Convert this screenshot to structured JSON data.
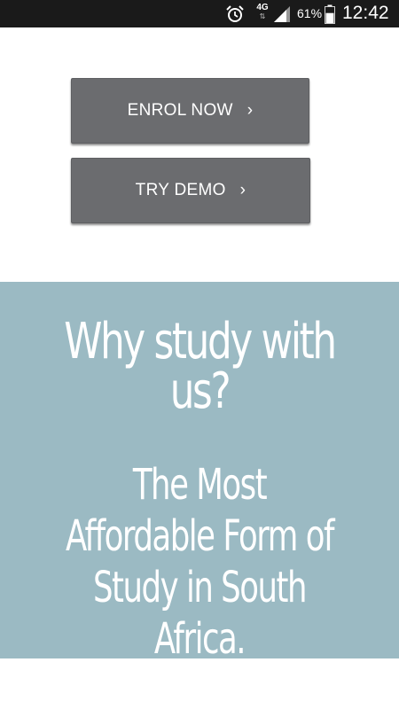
{
  "status_bar": {
    "network_type": "4G",
    "network_arrows": "⇅",
    "battery_percent": "61%",
    "battery_level": 0.61,
    "time": "12:42",
    "icons": [
      "alarm-icon",
      "network-icon",
      "signal-icon",
      "battery-icon"
    ]
  },
  "actions": {
    "enrol_label": "ENROL NOW",
    "demo_label": "TRY DEMO",
    "chevron": "›"
  },
  "promo": {
    "heading": "Why study with us?",
    "subheading": "The Most Affordable Form of Study in South Africa."
  },
  "colors": {
    "status_bar": "#1a1a1a",
    "button": "#6b6c6f",
    "promo_background": "#9bbac3",
    "text_light": "#ffffff"
  }
}
